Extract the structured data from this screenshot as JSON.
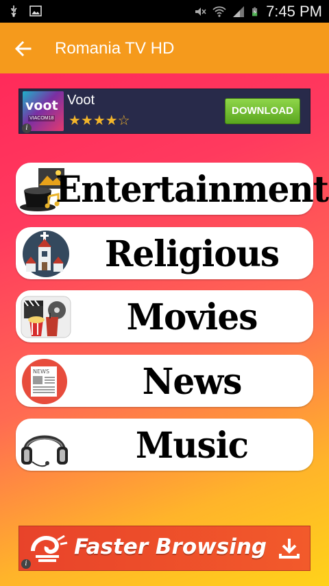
{
  "status_bar": {
    "time": "7:45 PM",
    "icons": [
      "usb-icon",
      "image-icon",
      "mute-icon",
      "wifi-icon",
      "signal-icon",
      "battery-charging-icon"
    ]
  },
  "app_bar": {
    "title": "Romania TV HD",
    "background_color": "#f59a1c"
  },
  "ad_top": {
    "logo_text": "voot",
    "logo_subtext": "VIACOM18",
    "app_name": "Voot",
    "rating_stars": 4,
    "rating_stars_text": "★★★★☆",
    "download_label": "DOWNLOAD",
    "info_glyph": "i"
  },
  "menu": {
    "items": [
      {
        "label": "Entertainment",
        "icon": "entertainment-icon"
      },
      {
        "label": "Religious",
        "icon": "church-icon"
      },
      {
        "label": "Movies",
        "icon": "movies-icon"
      },
      {
        "label": "News",
        "icon": "newspaper-icon"
      },
      {
        "label": "Music",
        "icon": "headphones-icon"
      }
    ]
  },
  "ad_bottom": {
    "text": "Faster Browsing",
    "info_glyph": "i"
  }
}
